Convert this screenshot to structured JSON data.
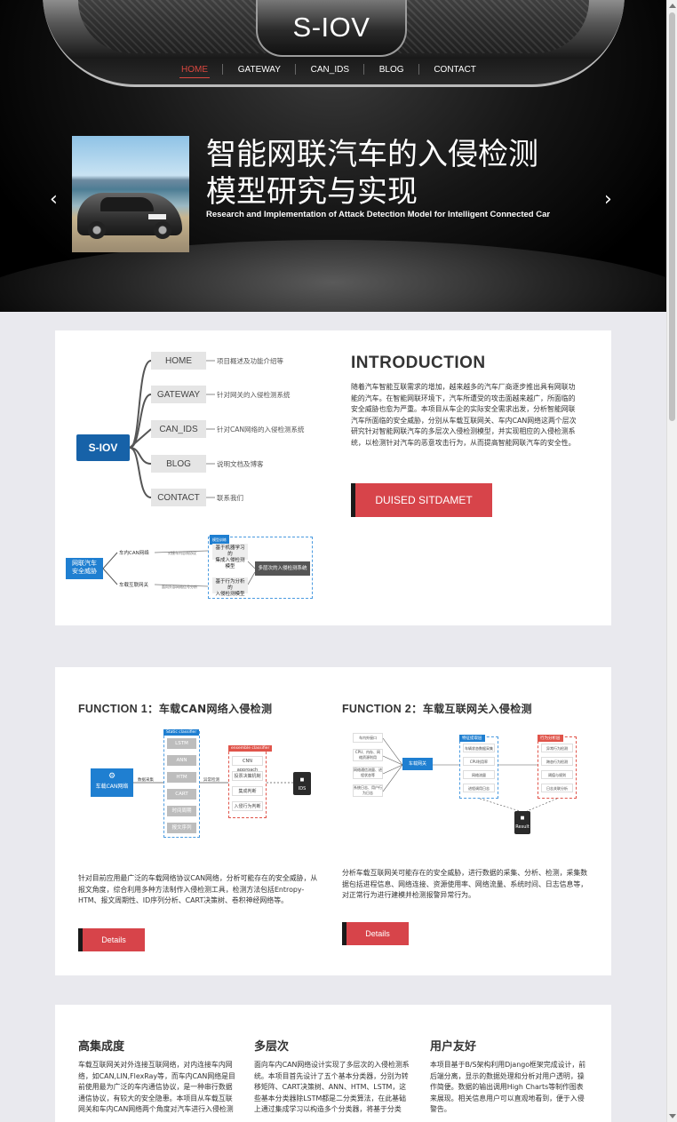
{
  "site": {
    "logo": "S-IOV"
  },
  "nav": {
    "items": [
      "HOME",
      "GATEWAY",
      "CAN_IDS",
      "BLOG",
      "CONTACT"
    ],
    "active": "HOME"
  },
  "hero": {
    "title_line1": "智能网联汽车的入侵检测",
    "title_line2": "模型研究与实现",
    "subtitle": "Research and Implementation of Attack Detection Model for Intelligent Connected Car",
    "prev_arrow": "‹",
    "next_arrow": "›"
  },
  "intro": {
    "mindmap": {
      "center": "S-IOV",
      "nodes": [
        {
          "label": "HOME",
          "desc": "项目概述及功能介绍等"
        },
        {
          "label": "GATEWAY",
          "desc": "针对网关的入侵检测系统"
        },
        {
          "label": "CAN_IDS",
          "desc": "针对CAN网络的入侵检测系统"
        },
        {
          "label": "BLOG",
          "desc": "说明文档及博客"
        },
        {
          "label": "CONTACT",
          "desc": "联系我们"
        }
      ]
    },
    "diagram": {
      "root": "网联汽车\n安全威胁",
      "branch1": "车内CAN网络",
      "branch2": "车载互联网关",
      "edge1": "对接车内总线协议",
      "edge2": "面向外部网络信号分析",
      "tag": "模型训练",
      "m1": "基于机器学习的\n集成入侵检测模型",
      "m2": "基于行为分析的\n入侵检测模型",
      "final": "多层次的入侵检测系统"
    },
    "title": "INTRODUCTION",
    "text": "随着汽车智能互联需求的增加，越来越多的汽车厂商逐步推出具有网联功能的汽车。在智能网联环境下，汽车所遭受的攻击面越来越广，所面临的安全威胁也愈为严重。本项目从车企的实际安全需求出发，分析智能网联汽车所面临的安全威胁，分别从车载互联网关、车内CAN网络这两个层次研究针对智能网联汽车的多层次入侵检测模型，并实现相应的入侵检测系统，以检测针对汽车的恶意攻击行为，从而提高智能网联汽车的安全性。",
    "button": "DUISED SITDAMET"
  },
  "functions": [
    {
      "title_prefix": "FUNCTION 1：",
      "title_cn": "车载CAN网络入侵检测",
      "diagram": {
        "source": "车载CAN网络",
        "edge_in": "数据采集",
        "tag1": "Static classifier",
        "algos": [
          "LSTM",
          "ANN",
          "HTM",
          "CART",
          "时间周期",
          "报文序列"
        ],
        "edge_mid": "异常检测",
        "tag2": "ensemble classifier",
        "ens": [
          "CNN approach",
          "投票决策机制",
          "集成判断",
          "入侵行为判断"
        ],
        "sink": "IDS"
      },
      "text": "针对目前应用最广泛的车载网络协议CAN网络，分析可能存在的安全威胁，从报文角度，综合利用多种方法制作入侵检测工具，检测方法包括Entropy-HTM、报文周期性、ID序列分析、CART决策树、卷积神经网络等。",
      "button": "Details"
    },
    {
      "title_prefix": "FUNCTION 2：",
      "title_cn": "车载互联网关入侵检测",
      "diagram": {
        "inputs": [
          "车内外接口",
          "CPU、内存、网络资源利用",
          "网络通信流量、进程状态等",
          "系统日志、用户行为日志"
        ],
        "hub": "车载网关",
        "tag1": "特征提取层",
        "feats": [
          "车辆状态数据采集",
          "CPU利用率",
          "网络流量",
          "进程调用日志"
        ],
        "tag2": "行为分析层",
        "beh": [
          "异常行为检测",
          "跨态行为检测",
          "阈值与规则",
          "日志关联分析"
        ],
        "sink": "Result"
      },
      "text": "分析车载互联网关可能存在的安全威胁，进行数据的采集、分析、检测，采集数据包括进程信息、网络连接、资源使用率、网络流量、系统时间、日志信息等，对正常行为进行建模并检测报警异常行为。",
      "button": "Details"
    }
  ],
  "features": [
    {
      "title": "高集成度",
      "text": "车载互联网关对外连接互联网络，对内连接车内网络，如CAN,LIN,FlexRay等，而车内CAN网络是目前使用最为广泛的车内通信协议，是一种串行数据通信协议，有较大的安全隐患。本项目从车载互联网关和车内CAN网络两个角度对汽车进行入侵检测"
    },
    {
      "title": "多层次",
      "text": "面向车内CAN网络设计实现了多层次的入侵检测系统。本项目首先设计了五个基本分类器，分别为转移矩阵、CART决策树、ANN、HTM、LSTM，这些基本分类器除LSTM都是二分类算法，在此基础上通过集成学习以构造多个分类器，将基于分类"
    },
    {
      "title": "用户友好",
      "text": "本项目基于B/S架构利用Django框架完成设计，前后端分离，显示的数据处理和分析对用户透明，操作简便。数据的输出调用High Charts等制作图表来展现。相关信息用户可以直观地看到，便于入侵警告。"
    }
  ]
}
